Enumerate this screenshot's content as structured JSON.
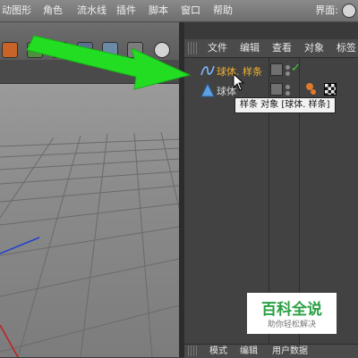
{
  "menubar": {
    "items": [
      "动图形",
      "角色",
      "流水线",
      "插件",
      "脚本",
      "窗口",
      "帮助"
    ],
    "layout_label": "界面:"
  },
  "object_manager": {
    "menu": [
      "文件",
      "编辑",
      "查看",
      "对象",
      "标签"
    ],
    "objects": [
      {
        "name": "球体. 样条",
        "icon": "spline-icon",
        "color": "#f0b030",
        "selected": true
      },
      {
        "name": "球体",
        "icon": "sphere-icon",
        "color": "#d8d8d8",
        "selected": false
      }
    ],
    "tooltip": "样条 对象 [球体. 样条]",
    "bottom_tabs": [
      "模式",
      "编辑",
      "用户数据"
    ]
  },
  "watermark": {
    "title": "百科全说",
    "subtitle": "助你轻松解决"
  },
  "colors": {
    "accent_green": "#22dd22",
    "spline_name": "#f0b030",
    "x_axis": "#c02020",
    "y_axis": "#2040d0"
  }
}
